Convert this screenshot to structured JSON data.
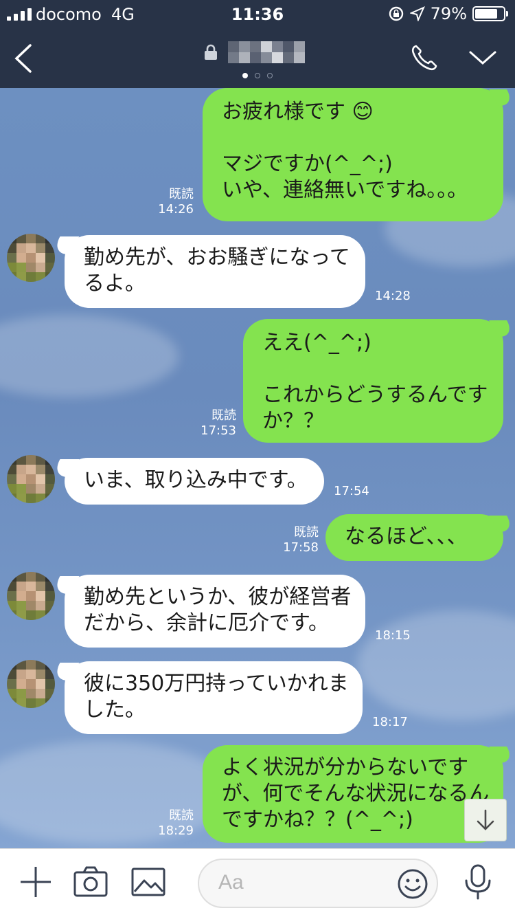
{
  "status_bar": {
    "carrier": "docomo",
    "network": "4G",
    "time": "11:36",
    "battery_percent": "79%",
    "battery_level": 0.79
  },
  "header": {
    "page_dots": 3,
    "active_dot": 0
  },
  "messages": [
    {
      "side": "out",
      "lines": [
        "お疲れ様です 😊",
        "",
        "マジですか(^_^;)",
        "いや、連絡無いですね。。。"
      ],
      "read": "既読",
      "time": "14:26"
    },
    {
      "side": "in",
      "lines": [
        "勤め先が、おお騒ぎになって",
        "るよ。"
      ],
      "time": "14:28"
    },
    {
      "side": "out",
      "lines": [
        "ええ(^_^;)",
        "",
        "これからどうするんです",
        "か？？"
      ],
      "read": "既読",
      "time": "17:53"
    },
    {
      "side": "in",
      "lines": [
        "いま、取り込み中です。"
      ],
      "time": "17:54"
    },
    {
      "side": "out",
      "lines": [
        "なるほど、、、"
      ],
      "read": "既読",
      "time": "17:58"
    },
    {
      "side": "in",
      "lines": [
        "勤め先というか、彼が経営者",
        "だから、余計に厄介です。"
      ],
      "time": "18:15"
    },
    {
      "side": "in",
      "lines": [
        "彼に350万円持っていかれま",
        "した。"
      ],
      "time": "18:17"
    },
    {
      "side": "out",
      "lines": [
        "よく状況が分からないです",
        "が、何でそんな状況になるん",
        "ですかね？？(^_^;)"
      ],
      "read": "既読",
      "time": "18:29"
    }
  ],
  "input": {
    "placeholder": "Aa"
  },
  "icons": {
    "back": "chevron-left-icon",
    "lock": "lock-icon",
    "call": "phone-icon",
    "menu": "chevron-down-icon",
    "plus": "plus-icon",
    "camera": "camera-icon",
    "image": "image-icon",
    "emoji": "smiley-icon",
    "mic": "microphone-icon",
    "scroll": "arrow-down-icon"
  },
  "colors": {
    "header": "#283347",
    "out_bubble": "#84e34f",
    "in_bubble": "#ffffff",
    "chat_bg": "#6d8fbf"
  }
}
